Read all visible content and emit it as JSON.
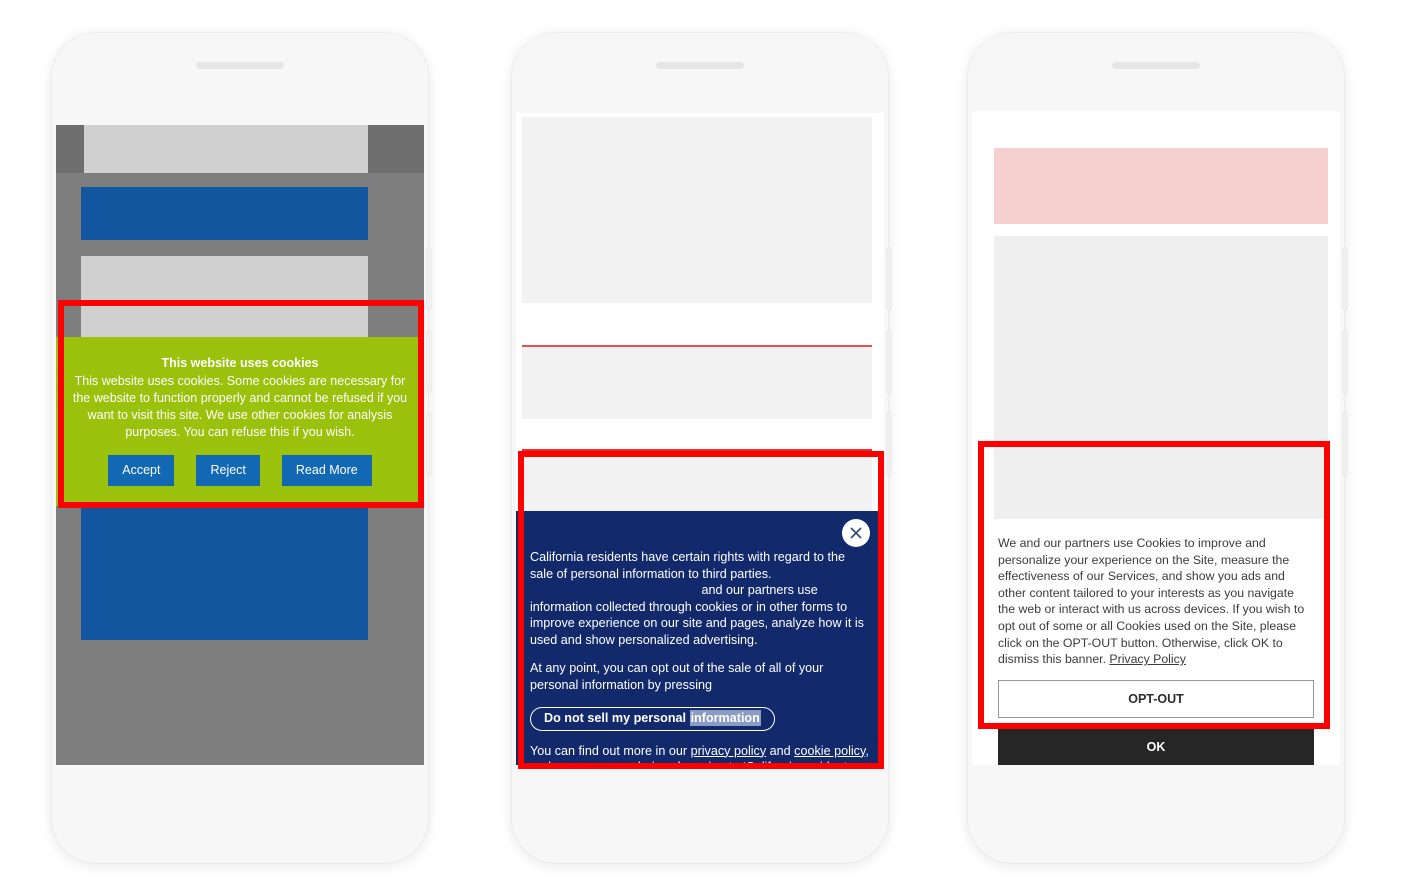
{
  "phones": [
    {
      "id": "phone-1",
      "page_blocks": [
        {
          "name": "page-background",
          "color": "#7e7e7e"
        },
        {
          "name": "header-strip",
          "color": "#d0d0d0"
        },
        {
          "name": "hero-blue-block",
          "color": "#11569f"
        },
        {
          "name": "content-gray-block",
          "color": "#d0d0d0"
        },
        {
          "name": "footer-blue-block",
          "color": "#11569f"
        }
      ],
      "banner": {
        "type": "green-cookie-banner",
        "background_color": "#9ac10b",
        "title": "This website uses cookies",
        "body": "This website uses cookies. Some cookies are necessary for the website to function properly and cannot be refused if you want to visit this site. We use other cookies for analysis purposes. You can refuse this if you wish.",
        "buttons": [
          {
            "name": "accept-button",
            "label": "Accept"
          },
          {
            "name": "reject-button",
            "label": "Reject"
          },
          {
            "name": "read-more-button",
            "label": "Read More"
          }
        ],
        "button_color": "#1268b3"
      }
    },
    {
      "id": "phone-2",
      "page_blocks": [
        {
          "name": "page-background",
          "color": "#ffffff"
        },
        {
          "name": "content-block-1",
          "color": "#f2f2f2"
        },
        {
          "name": "red-divider-1",
          "color": "#e03030"
        },
        {
          "name": "content-block-2",
          "color": "#f2f2f2"
        },
        {
          "name": "red-divider-2",
          "color": "#e03030"
        },
        {
          "name": "content-block-3",
          "color": "#f2f2f2"
        }
      ],
      "banner": {
        "type": "navy-ccpa-banner",
        "background_color": "#12296b",
        "close_icon": "close-x-icon",
        "paragraph_1_part_a": "California residents have certain rights with regard to the sale of personal information to third parties.",
        "paragraph_1_part_b": "and our partners use information collected through cookies or in other forms to improve experience on our site and pages, analyze how it is used and show personalized advertising.",
        "paragraph_2": "At any point, you can opt out of the sale of all of your personal information by pressing",
        "do_not_sell_button_prefix": "Do not sell my personal ",
        "do_not_sell_button_highlight": "information",
        "paragraph_3_part_1": "You can find out more in our ",
        "privacy_policy_link": "privacy policy",
        "paragraph_3_part_2": " and ",
        "cookie_policy_link": "cookie policy",
        "paragraph_3_part_3": ", and manage your choices by going to ‘California resident – Do Not Sell’ at the bottom of any page."
      }
    },
    {
      "id": "phone-3",
      "page_blocks": [
        {
          "name": "page-background",
          "color": "#ffffff"
        },
        {
          "name": "pink-hero-block",
          "color": "#f6cfcf"
        },
        {
          "name": "content-gray-block",
          "color": "#efefef"
        }
      ],
      "banner": {
        "type": "white-optout-banner",
        "background_color": "#ffffff",
        "body_part_1": "We and our partners use Cookies to improve and personalize your experience on the Site, measure the effectiveness of our Services, and show you ads and other content tailored to your interests as you navigate the web or interact with us across devices. If you wish to opt out of some or all Cookies used on the Site, please click on the OPT-OUT button. Otherwise, click OK to dismiss this banner. ",
        "privacy_policy_link": "Privacy Policy",
        "optout_button_label": "OPT-OUT",
        "ok_button_label": "OK",
        "ok_button_color": "#262626"
      }
    }
  ],
  "highlight_color": "#ff0000"
}
